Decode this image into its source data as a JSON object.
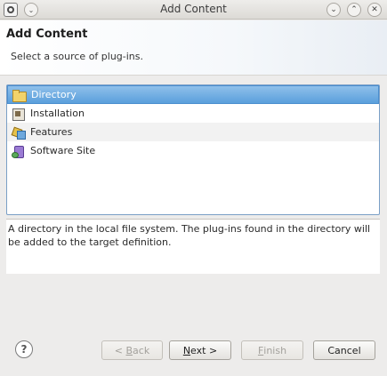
{
  "window": {
    "title": "Add Content",
    "menu_glyph": "⌄",
    "controls": {
      "minimize": "⌄",
      "maximize": "⌃",
      "close": "✕"
    }
  },
  "header": {
    "title": "Add Content",
    "description": "Select a source of plug-ins."
  },
  "sources": [
    {
      "label": "Directory",
      "icon": "folder-icon",
      "selected": true
    },
    {
      "label": "Installation",
      "icon": "installation-icon",
      "selected": false
    },
    {
      "label": "Features",
      "icon": "features-icon",
      "selected": false
    },
    {
      "label": "Software Site",
      "icon": "software-site-icon",
      "selected": false
    }
  ],
  "details": {
    "text": "A directory in the local file system. The plug-ins found in the directory will be added to the target definition."
  },
  "buttons": {
    "help": "?",
    "back": {
      "prefix": "< ",
      "mnemonic": "B",
      "rest": "ack",
      "enabled": false
    },
    "next": {
      "mnemonic": "N",
      "rest": "ext >",
      "enabled": true
    },
    "finish": {
      "mnemonic": "F",
      "rest": "inish",
      "enabled": false
    },
    "cancel": {
      "label": "Cancel",
      "enabled": true
    }
  }
}
